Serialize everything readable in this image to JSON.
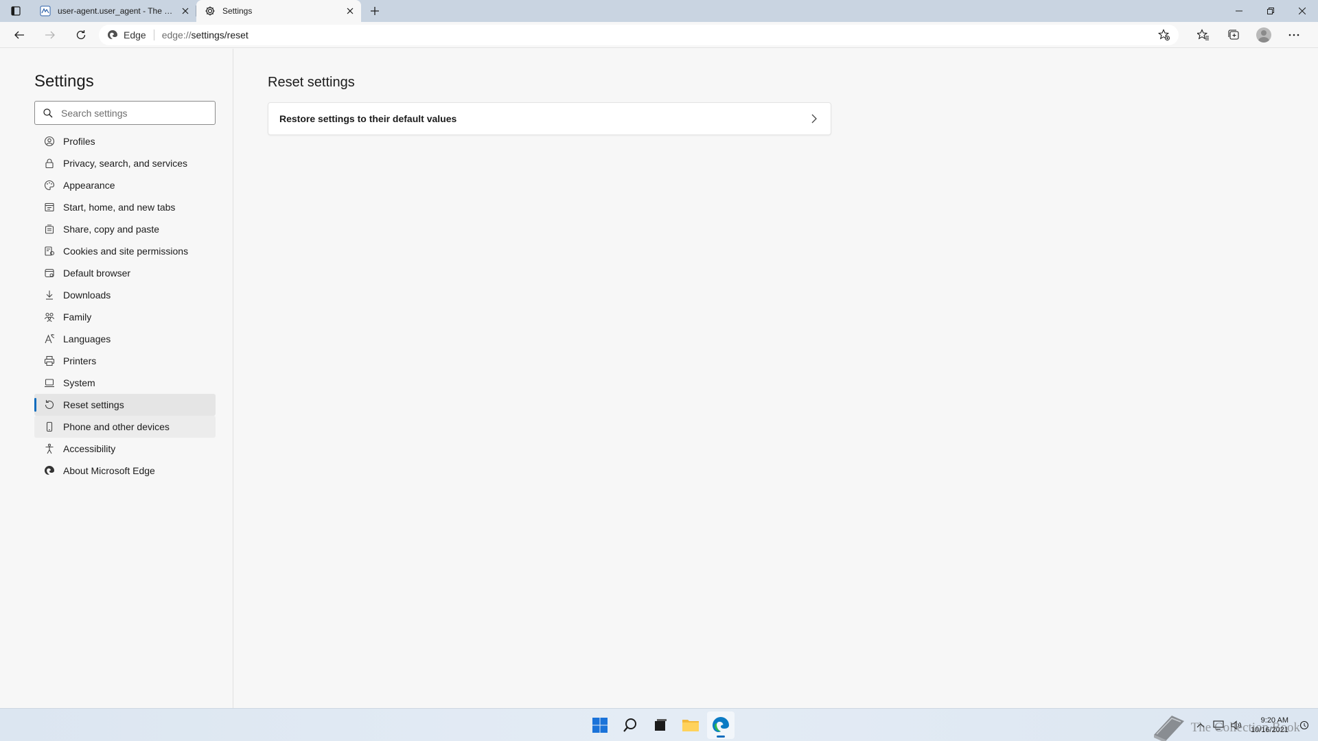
{
  "window": {
    "tabs": [
      {
        "title": "user-agent.user_agent - The Coll",
        "icon": "document-favicon",
        "active": false
      },
      {
        "title": "Settings",
        "icon": "gear-icon",
        "active": true
      }
    ]
  },
  "toolbar": {
    "site_label": "Edge",
    "url_prefix": "edge://",
    "url_main": "settings/reset"
  },
  "sidebar": {
    "title": "Settings",
    "search_placeholder": "Search settings",
    "items": [
      {
        "label": "Profiles",
        "icon": "profile-icon"
      },
      {
        "label": "Privacy, search, and services",
        "icon": "lock-icon"
      },
      {
        "label": "Appearance",
        "icon": "palette-icon"
      },
      {
        "label": "Start, home, and new tabs",
        "icon": "power-icon"
      },
      {
        "label": "Share, copy and paste",
        "icon": "share-icon"
      },
      {
        "label": "Cookies and site permissions",
        "icon": "cookies-icon"
      },
      {
        "label": "Default browser",
        "icon": "browser-icon"
      },
      {
        "label": "Downloads",
        "icon": "download-icon"
      },
      {
        "label": "Family",
        "icon": "family-icon"
      },
      {
        "label": "Languages",
        "icon": "languages-icon"
      },
      {
        "label": "Printers",
        "icon": "printer-icon"
      },
      {
        "label": "System",
        "icon": "system-icon"
      },
      {
        "label": "Reset settings",
        "icon": "reset-icon",
        "selected": true
      },
      {
        "label": "Phone and other devices",
        "icon": "phone-icon"
      },
      {
        "label": "Accessibility",
        "icon": "accessibility-icon"
      },
      {
        "label": "About Microsoft Edge",
        "icon": "edge-icon"
      }
    ]
  },
  "main": {
    "title": "Reset settings",
    "card_label": "Restore settings to their default values"
  },
  "taskbar": {
    "time": "9:20 AM",
    "date": "10/16/2021",
    "watermark": "The Collection Book"
  },
  "colors": {
    "accent": "#0f6cbd",
    "tabstrip": "#c9d4e1",
    "background": "#f7f7f7"
  }
}
